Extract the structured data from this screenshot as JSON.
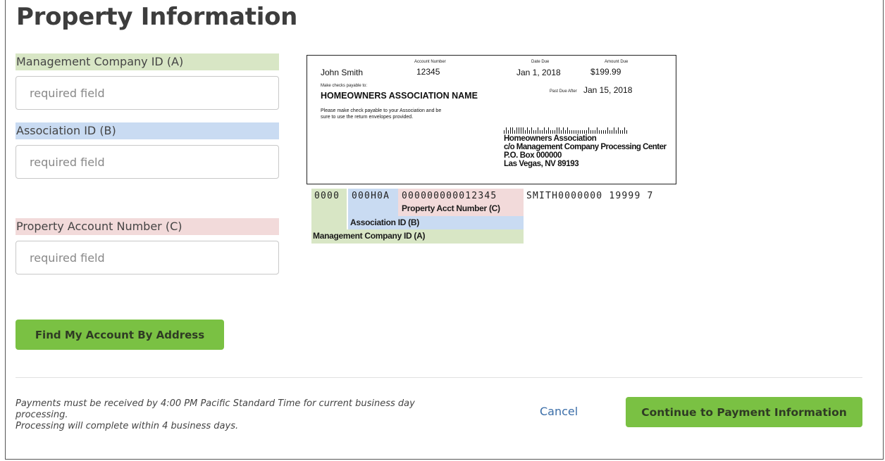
{
  "page": {
    "title": "Property Information"
  },
  "form": {
    "management_company": {
      "label": "Management Company ID (A)",
      "placeholder": "required field"
    },
    "association": {
      "label": "Association ID (B)",
      "placeholder": "required field"
    },
    "property_account": {
      "label": "Property Account Number (C)",
      "placeholder": "required field"
    },
    "find_button": "Find My Account By Address"
  },
  "bill": {
    "account_number_label": "Account Number",
    "date_due_label": "Date Due",
    "amount_due_label": "Amount Due",
    "name": "John Smith",
    "account_number": "12345",
    "date_due": "Jan 1, 2018",
    "amount_due": "$199.99",
    "payable_to_label": "Make checks payable to:",
    "payable_to": "HOMEOWNERS  ASSOCIATION NAME",
    "past_due_label": "Past Due After",
    "past_due_date": "Jan 15, 2018",
    "instructions_line1": "Please make check payable to your Association and be",
    "instructions_line2": "sure to use the return envelopes  provided.",
    "address_line1": "Homeowners Association",
    "address_line2": "c/o Management Company Processing Center",
    "address_line3": "P.O. Box 000000",
    "address_line4": "Las Vegas, NV 89193"
  },
  "micr": {
    "mgmt": "0000",
    "assoc": "000H0A",
    "account": "000000000012345",
    "rest": "SMITH0000000 19999 7",
    "label_c": "Property Acct Number (C)",
    "label_b": "Association ID (B)",
    "label_a": "Management Company ID (A)"
  },
  "footer": {
    "note_line1": "Payments must be received by 4:00 PM Pacific Standard Time for current business day",
    "note_line1b": "processing.",
    "note_line2": "Processing will complete within 4 business days.",
    "cancel": "Cancel",
    "continue": "Continue to Payment Information"
  },
  "colors": {
    "accent_green": "#7ac143",
    "label_green": "#d8e6c5",
    "label_blue": "#c9dbf2",
    "label_pink": "#f2dada",
    "link_blue": "#3b6ea8"
  }
}
